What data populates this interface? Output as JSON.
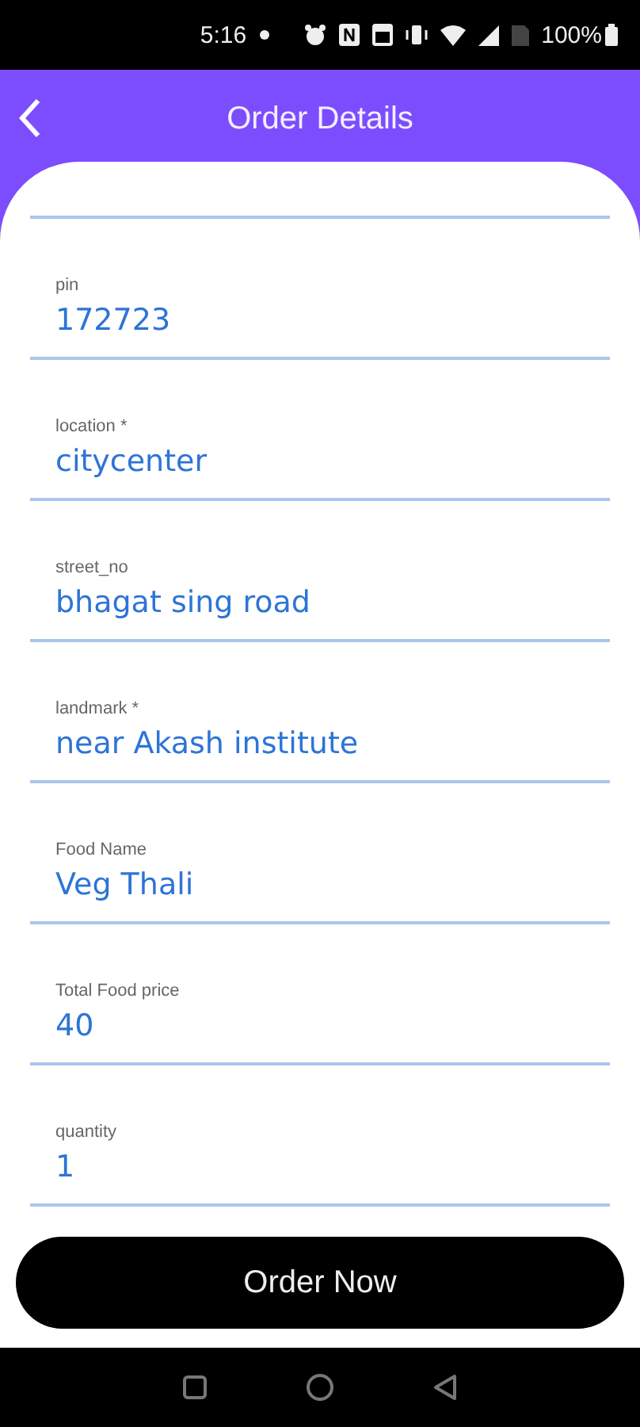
{
  "status_bar": {
    "time": "5:16",
    "battery": "100%"
  },
  "header": {
    "title": "Order Details"
  },
  "fields": [
    {
      "label": "pin",
      "value": "172723"
    },
    {
      "label": "location *",
      "value": "citycenter"
    },
    {
      "label": "street_no",
      "value": "bhagat sing road"
    },
    {
      "label": "landmark *",
      "value": "near Akash institute"
    },
    {
      "label": "Food Name",
      "value": "Veg Thali"
    },
    {
      "label": "Total Food price",
      "value": "40"
    },
    {
      "label": "quantity",
      "value": "1"
    }
  ],
  "order_button": {
    "label": "Order Now"
  }
}
